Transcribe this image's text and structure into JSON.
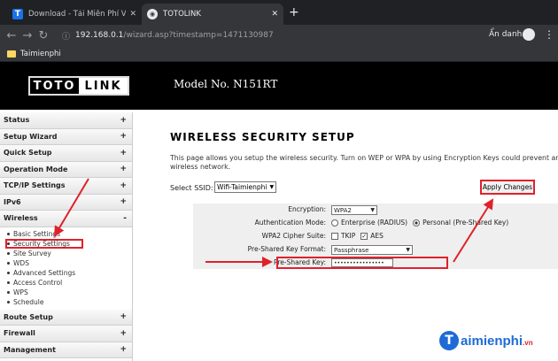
{
  "browser": {
    "tabs": [
      {
        "label": "Download - Tải Miễn Phí VN - Pl",
        "favicon": "T"
      },
      {
        "label": "TOTOLINK"
      }
    ],
    "url_host": "192.168.0.1",
    "url_path": "/wizard.asp?timestamp=1471130987",
    "profile_label": "Ẩn danh",
    "bookmark": "Taimienphi"
  },
  "header": {
    "logo_left": "TOTO",
    "logo_right": "LINK",
    "model": "Model No. N151RT"
  },
  "sidebar": {
    "items": [
      {
        "label": "Status",
        "sign": "+"
      },
      {
        "label": "Setup Wizard",
        "sign": "+"
      },
      {
        "label": "Quick Setup",
        "sign": "+"
      },
      {
        "label": "Operation Mode",
        "sign": "+"
      },
      {
        "label": "TCP/IP Settings",
        "sign": "+"
      },
      {
        "label": "IPv6",
        "sign": "+"
      },
      {
        "label": "Wireless",
        "sign": "-"
      }
    ],
    "wireless_sub": [
      "Basic Settings",
      "Security Settings",
      "Site Survey",
      "WDS",
      "Advanced Settings",
      "Access Control",
      "WPS",
      "Schedule"
    ],
    "items_after": [
      {
        "label": "Route Setup",
        "sign": "+"
      },
      {
        "label": "Firewall",
        "sign": "+"
      },
      {
        "label": "Management",
        "sign": "+"
      }
    ]
  },
  "main": {
    "title": "WIRELESS SECURITY SETUP",
    "description_line1": "This page allows you setup the wireless security. Turn on WEP or WPA by using Encryption Keys could prevent any unautho",
    "description_line2": "wireless network.",
    "ssid_label": "Select SSID:",
    "ssid_value": "Wifi-Taimienphi",
    "apply_label": "Apply Changes",
    "form": {
      "encryption_label": "Encryption:",
      "encryption_value": "WPA2",
      "auth_label": "Authentication Mode:",
      "auth_opt1": "Enterprise (RADIUS)",
      "auth_opt2": "Personal (Pre-Shared Key)",
      "cipher_label": "WPA2 Cipher Suite:",
      "cipher_opt1": "TKIP",
      "cipher_opt2": "AES",
      "format_label": "Pre-Shared Key Format:",
      "format_value": "Passphrase",
      "psk_label": "Pre-Shared Key:",
      "psk_value": "••••••••••••••••"
    }
  },
  "watermark": {
    "letter": "T",
    "text": "aimienphi",
    "suffix": ".vn"
  },
  "colors": {
    "highlight": "#e0212b",
    "brand": "#1e6bd6"
  }
}
